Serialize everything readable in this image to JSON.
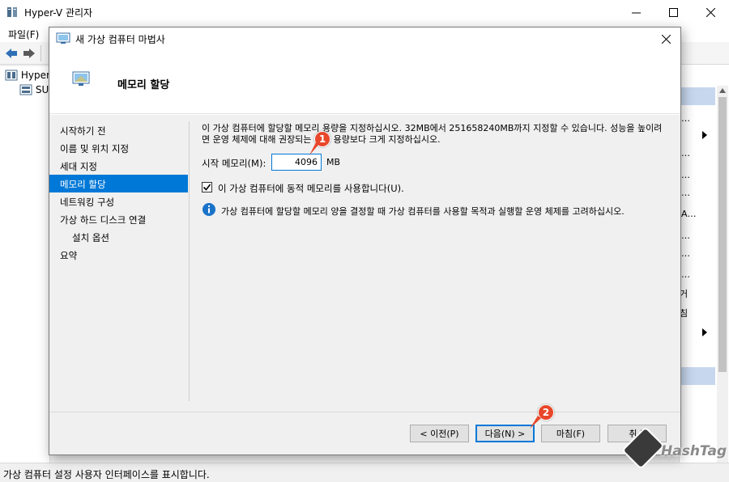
{
  "main_window": {
    "title": "Hyper-V 관리자",
    "menu": {
      "file": "파일(F)"
    },
    "tree": {
      "root": "Hyper-V",
      "server": "SU"
    },
    "actions": {
      "items": [
        "거",
        "침"
      ]
    },
    "status": "가상 컴퓨터 설정 사용자 인터페이스를 표시합니다."
  },
  "wizard": {
    "title": "새 가상 컴퓨터 마법사",
    "page_title": "메모리 할당",
    "nav": [
      "시작하기 전",
      "이름 및 위치 지정",
      "세대 지정",
      "메모리 할당",
      "네트워킹 구성",
      "가상 하드 디스크 연결",
      "설치 옵션",
      "요약"
    ],
    "description": "이 가상 컴퓨터에 할당할 메모리 용량을 지정하십시오. 32MB에서 251658240MB까지 지정할 수 있습니다. 성능을 높이려면 운영 체제에 대해 권장되는 최소 용량보다 크게 지정하십시오.",
    "startup_memory_label": "시작 메모리(M):",
    "startup_memory_value": "4096",
    "startup_memory_unit": "MB",
    "dynamic_memory_label": "이 가상 컴퓨터에 동적 메모리를 사용합니다(U).",
    "dynamic_memory_checked": true,
    "info_text": "가상 컴퓨터에 할당할 메모리 양을 결정할 때 가상 컴퓨터를 사용할 목적과 실행할 운영 체제를 고려하십시오.",
    "buttons": {
      "previous": "< 이전(P)",
      "next": "다음(N) >",
      "finish": "마침(F)",
      "cancel": "취소"
    }
  },
  "callouts": [
    "1",
    "2"
  ],
  "watermark": "HashTag",
  "colors": {
    "selection": "#0078d7",
    "callout": "#e8472a",
    "info": "#1a73c8"
  }
}
